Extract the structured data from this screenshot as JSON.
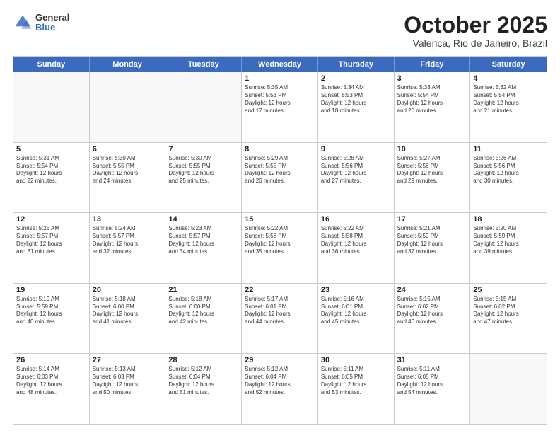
{
  "logo": {
    "general": "General",
    "blue": "Blue"
  },
  "header": {
    "month": "October 2025",
    "location": "Valenca, Rio de Janeiro, Brazil"
  },
  "weekdays": [
    "Sunday",
    "Monday",
    "Tuesday",
    "Wednesday",
    "Thursday",
    "Friday",
    "Saturday"
  ],
  "rows": [
    [
      {
        "day": "",
        "info": ""
      },
      {
        "day": "",
        "info": ""
      },
      {
        "day": "",
        "info": ""
      },
      {
        "day": "1",
        "info": "Sunrise: 5:35 AM\nSunset: 5:53 PM\nDaylight: 12 hours\nand 17 minutes."
      },
      {
        "day": "2",
        "info": "Sunrise: 5:34 AM\nSunset: 5:53 PM\nDaylight: 12 hours\nand 18 minutes."
      },
      {
        "day": "3",
        "info": "Sunrise: 5:33 AM\nSunset: 5:54 PM\nDaylight: 12 hours\nand 20 minutes."
      },
      {
        "day": "4",
        "info": "Sunrise: 5:32 AM\nSunset: 5:54 PM\nDaylight: 12 hours\nand 21 minutes."
      }
    ],
    [
      {
        "day": "5",
        "info": "Sunrise: 5:31 AM\nSunset: 5:54 PM\nDaylight: 12 hours\nand 22 minutes."
      },
      {
        "day": "6",
        "info": "Sunrise: 5:30 AM\nSunset: 5:55 PM\nDaylight: 12 hours\nand 24 minutes."
      },
      {
        "day": "7",
        "info": "Sunrise: 5:30 AM\nSunset: 5:55 PM\nDaylight: 12 hours\nand 25 minutes."
      },
      {
        "day": "8",
        "info": "Sunrise: 5:29 AM\nSunset: 5:55 PM\nDaylight: 12 hours\nand 26 minutes."
      },
      {
        "day": "9",
        "info": "Sunrise: 5:28 AM\nSunset: 5:56 PM\nDaylight: 12 hours\nand 27 minutes."
      },
      {
        "day": "10",
        "info": "Sunrise: 5:27 AM\nSunset: 5:56 PM\nDaylight: 12 hours\nand 29 minutes."
      },
      {
        "day": "11",
        "info": "Sunrise: 5:26 AM\nSunset: 5:56 PM\nDaylight: 12 hours\nand 30 minutes."
      }
    ],
    [
      {
        "day": "12",
        "info": "Sunrise: 5:25 AM\nSunset: 5:57 PM\nDaylight: 12 hours\nand 31 minutes."
      },
      {
        "day": "13",
        "info": "Sunrise: 5:24 AM\nSunset: 5:57 PM\nDaylight: 12 hours\nand 32 minutes."
      },
      {
        "day": "14",
        "info": "Sunrise: 5:23 AM\nSunset: 5:57 PM\nDaylight: 12 hours\nand 34 minutes."
      },
      {
        "day": "15",
        "info": "Sunrise: 5:22 AM\nSunset: 5:58 PM\nDaylight: 12 hours\nand 35 minutes."
      },
      {
        "day": "16",
        "info": "Sunrise: 5:22 AM\nSunset: 5:58 PM\nDaylight: 12 hours\nand 36 minutes."
      },
      {
        "day": "17",
        "info": "Sunrise: 5:21 AM\nSunset: 5:59 PM\nDaylight: 12 hours\nand 37 minutes."
      },
      {
        "day": "18",
        "info": "Sunrise: 5:20 AM\nSunset: 5:59 PM\nDaylight: 12 hours\nand 39 minutes."
      }
    ],
    [
      {
        "day": "19",
        "info": "Sunrise: 5:19 AM\nSunset: 5:59 PM\nDaylight: 12 hours\nand 40 minutes."
      },
      {
        "day": "20",
        "info": "Sunrise: 5:18 AM\nSunset: 6:00 PM\nDaylight: 12 hours\nand 41 minutes."
      },
      {
        "day": "21",
        "info": "Sunrise: 5:18 AM\nSunset: 6:00 PM\nDaylight: 12 hours\nand 42 minutes."
      },
      {
        "day": "22",
        "info": "Sunrise: 5:17 AM\nSunset: 6:01 PM\nDaylight: 12 hours\nand 44 minutes."
      },
      {
        "day": "23",
        "info": "Sunrise: 5:16 AM\nSunset: 6:01 PM\nDaylight: 12 hours\nand 45 minutes."
      },
      {
        "day": "24",
        "info": "Sunrise: 5:15 AM\nSunset: 6:02 PM\nDaylight: 12 hours\nand 46 minutes."
      },
      {
        "day": "25",
        "info": "Sunrise: 5:15 AM\nSunset: 6:02 PM\nDaylight: 12 hours\nand 47 minutes."
      }
    ],
    [
      {
        "day": "26",
        "info": "Sunrise: 5:14 AM\nSunset: 6:03 PM\nDaylight: 12 hours\nand 48 minutes."
      },
      {
        "day": "27",
        "info": "Sunrise: 5:13 AM\nSunset: 6:03 PM\nDaylight: 12 hours\nand 50 minutes."
      },
      {
        "day": "28",
        "info": "Sunrise: 5:12 AM\nSunset: 6:04 PM\nDaylight: 12 hours\nand 51 minutes."
      },
      {
        "day": "29",
        "info": "Sunrise: 5:12 AM\nSunset: 6:04 PM\nDaylight: 12 hours\nand 52 minutes."
      },
      {
        "day": "30",
        "info": "Sunrise: 5:11 AM\nSunset: 6:05 PM\nDaylight: 12 hours\nand 53 minutes."
      },
      {
        "day": "31",
        "info": "Sunrise: 5:11 AM\nSunset: 6:05 PM\nDaylight: 12 hours\nand 54 minutes."
      },
      {
        "day": "",
        "info": ""
      }
    ]
  ]
}
